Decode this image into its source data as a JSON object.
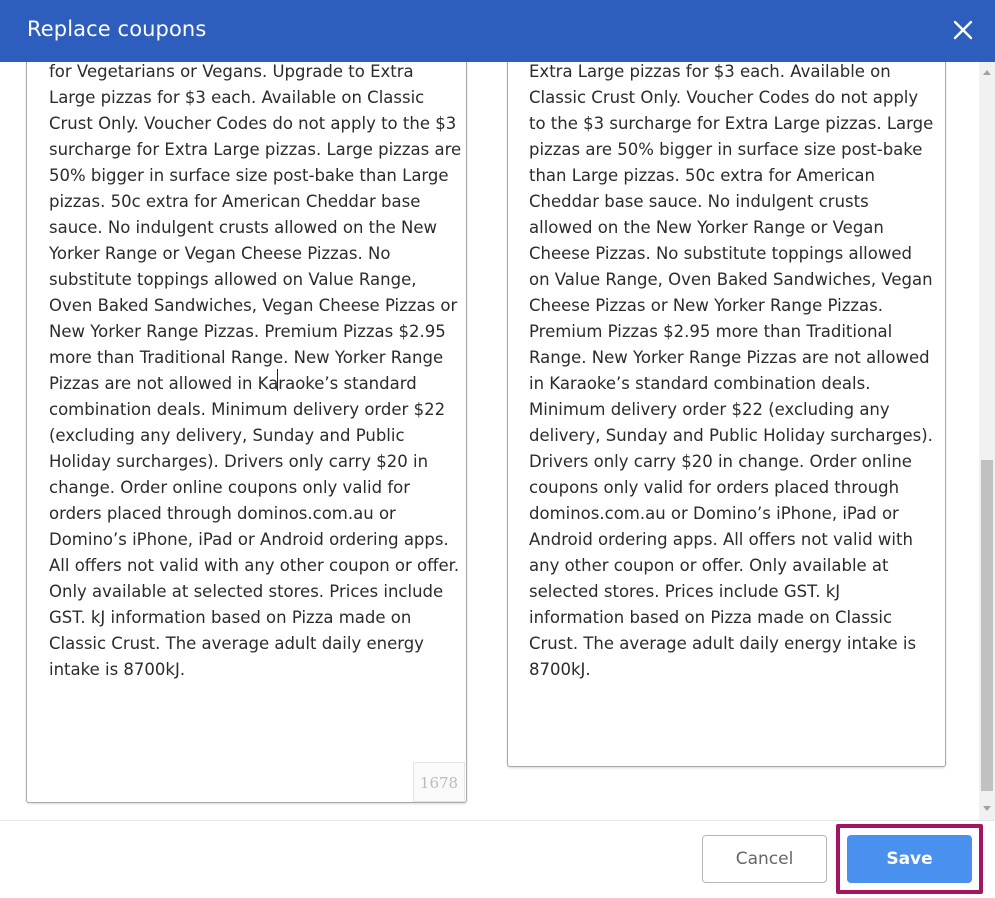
{
  "dialog": {
    "title": "Replace coupons"
  },
  "icons": {
    "close": "close-icon",
    "scroll_up": "chevron-up-icon",
    "scroll_down": "chevron-down-icon"
  },
  "left_textbox": {
    "text": "Gluten Free & Vegan Mozzarella. Garlic Bread\nCrust contains animal products & is not suitable\nfor Vegetarians or Vegans. Upgrade to Extra\nLarge pizzas for $3 each. Available on Classic\nCrust Only. Voucher Codes do not apply to the $3\nsurcharge for Extra Large pizzas. Large pizzas are\n50% bigger in surface size post-bake than Large\npizzas. 50c extra for American Cheddar base\nsauce. No indulgent crusts allowed on the New\nYorker Range or Vegan Cheese Pizzas. No\nsubstitute toppings allowed on Value Range,\nOven Baked Sandwiches, Vegan Cheese Pizzas or\nNew Yorker Range Pizzas. Premium Pizzas $2.95\nmore than Traditional Range. New Yorker Range\nPizzas are not allowed in Karaoke’s standard\ncombination deals. Minimum delivery order $22\n(excluding any delivery, Sunday and Public\nHoliday surcharges). Drivers only carry $20 in\nchange. Order online coupons only valid for\norders placed through dominos.com.au or\nDomino’s iPhone, iPad or Android ordering apps.\nAll offers not valid with any other coupon or offer.\nOnly available at selected stores. Prices include\nGST. kJ information based on Pizza made on\nClassic Crust. The average adult daily energy\nintake is 8700kJ.",
    "char_count": "1678"
  },
  "right_textbox": {
    "text": "Bread Crust contains animal products & is not\nsuitable for Vegetarians or Vegans. Upgrade to\nExtra Large pizzas for $3 each. Available on\nClassic Crust Only. Voucher Codes do not apply\nto the $3 surcharge for Extra Large pizzas. Large\npizzas are 50% bigger in surface size post-bake\nthan Large pizzas. 50c extra for American\nCheddar base sauce. No indulgent crusts\nallowed on the New Yorker Range or Vegan\nCheese Pizzas. No substitute toppings allowed\non Value Range, Oven Baked Sandwiches, Vegan\nCheese Pizzas or New Yorker Range Pizzas.\nPremium Pizzas $2.95 more than Traditional\nRange. New Yorker Range Pizzas are not allowed\nin Karaoke’s standard combination deals.\nMinimum delivery order $22 (excluding any\ndelivery, Sunday and Public Holiday surcharges).\nDrivers only carry $20 in change. Order online\ncoupons only valid for orders placed through\ndominos.com.au or Domino’s iPhone, iPad or\nAndroid ordering apps. All offers not valid with\nany other coupon or offer. Only available at\nselected stores. Prices include GST. kJ\ninformation based on Pizza made on Classic\nCrust. The average adult daily energy intake is\n8700kJ."
  },
  "footer": {
    "cancel_label": "Cancel",
    "save_label": "Save"
  },
  "colors": {
    "header_bg": "#2d5dbd",
    "save_bg": "#4a90ee",
    "save_highlight": "#a3155e"
  }
}
